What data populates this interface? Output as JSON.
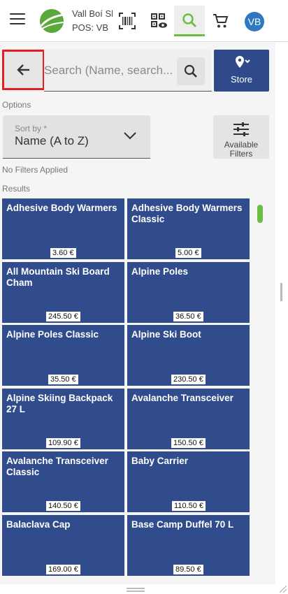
{
  "header": {
    "store_name": "Vall Boí Ski",
    "pos_name": "POS: VB",
    "avatar_initials": "VB",
    "accent_color": "#6cbd45",
    "brand_color": "#2f4a8a"
  },
  "search": {
    "placeholder": "Search (Name, search...",
    "value": "",
    "store_button_label": "Store"
  },
  "options": {
    "section_label": "Options",
    "sort_label": "Sort by *",
    "sort_value": "Name (A to Z)",
    "filters_button_label": "Available Filters",
    "filter_status": "No Filters Applied"
  },
  "results": {
    "section_label": "Results",
    "items": [
      {
        "name": "Adhesive Body Warmers",
        "price": "3.60 €"
      },
      {
        "name": "Adhesive Body Warmers Classic",
        "price": "5.00 €"
      },
      {
        "name": "All Mountain Ski Board Cham",
        "price": "245.50 €"
      },
      {
        "name": "Alpine Poles",
        "price": "36.50 €"
      },
      {
        "name": "Alpine Poles Classic",
        "price": "35.50 €"
      },
      {
        "name": "Alpine Ski Boot",
        "price": "230.50 €"
      },
      {
        "name": "Alpine Skiing Backpack 27 L",
        "price": "109.90 €"
      },
      {
        "name": "Avalanche Transceiver",
        "price": "150.50 €"
      },
      {
        "name": "Avalanche Transceiver Classic",
        "price": "140.50 €"
      },
      {
        "name": "Baby Carrier",
        "price": "110.50 €"
      },
      {
        "name": "Balaclava Cap",
        "price": "169.00 €"
      },
      {
        "name": "Base Camp Duffel 70 L",
        "price": "89.50 €"
      }
    ]
  }
}
